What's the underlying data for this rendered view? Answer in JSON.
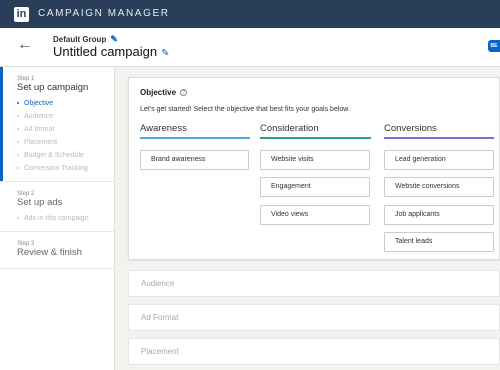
{
  "app": {
    "logo": "in",
    "title": "CAMPAIGN MANAGER"
  },
  "header": {
    "group_label": "Default Group",
    "campaign_title": "Untitled campaign",
    "corner_badge": "BE"
  },
  "sidebar": {
    "steps": [
      {
        "num": "Step 1",
        "title": "Set up campaign",
        "items": [
          "Objective",
          "Audience",
          "Ad format",
          "Placement",
          "Budget & Schedule",
          "Conversion Tracking"
        ]
      },
      {
        "num": "Step 2",
        "title": "Set up ads",
        "items": [
          "Ads in this campaign"
        ]
      },
      {
        "num": "Step 3",
        "title": "Review & finish",
        "items": []
      }
    ]
  },
  "objective": {
    "title": "Objective",
    "subtitle": "Let's get started! Select the objective that best fits your goals below.",
    "columns": [
      {
        "name": "Awareness",
        "color": "#51a9d8",
        "options": [
          "Brand awareness"
        ]
      },
      {
        "name": "Consideration",
        "color": "#2e9d8e",
        "options": [
          "Website visits",
          "Engagement",
          "Video views"
        ]
      },
      {
        "name": "Conversions",
        "color": "#7e6ed6",
        "options": [
          "Lead generation",
          "Website conversions",
          "Job applicants",
          "Talent leads"
        ]
      }
    ]
  },
  "sections": [
    "Audience",
    "Ad Format",
    "Placement"
  ]
}
